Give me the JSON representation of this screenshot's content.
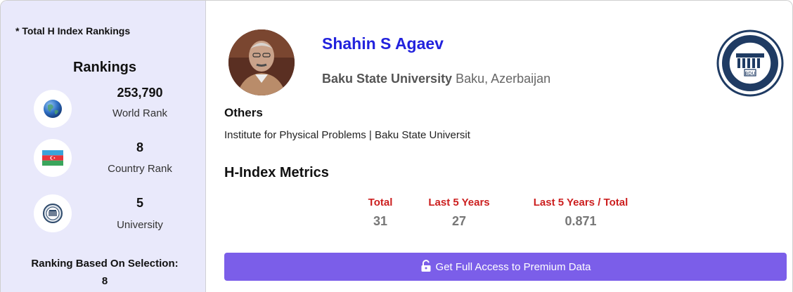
{
  "sidebar": {
    "note": "* Total H Index Rankings",
    "title": "Rankings",
    "ranks": [
      {
        "value": "253,790",
        "label": "World Rank",
        "icon": "globe-icon"
      },
      {
        "value": "8",
        "label": "Country Rank",
        "icon": "azerbaijan-flag-icon"
      },
      {
        "value": "5",
        "label": "University",
        "icon": "university-seal-icon"
      }
    ],
    "selection_label": "Ranking Based On Selection:",
    "selection_value": "8"
  },
  "profile": {
    "name": "Shahin S Agaev",
    "university": "Baku State University",
    "location": "Baku, Azerbaijan",
    "logo_text": "BDU"
  },
  "others": {
    "heading": "Others",
    "text": "Institute for Physical Problems | Baku State Universit"
  },
  "metrics": {
    "heading": "H-Index Metrics",
    "columns": [
      {
        "header": "Total",
        "value": "31"
      },
      {
        "header": "Last 5 Years",
        "value": "27"
      },
      {
        "header": "Last 5 Years / Total",
        "value": "0.871"
      }
    ]
  },
  "premium_button": "Get Full Access to Premium Data",
  "colors": {
    "sidebar_bg": "#e9e9fb",
    "name": "#2222dd",
    "metric_header": "#cc1f1f",
    "button": "#7b5ee9"
  }
}
